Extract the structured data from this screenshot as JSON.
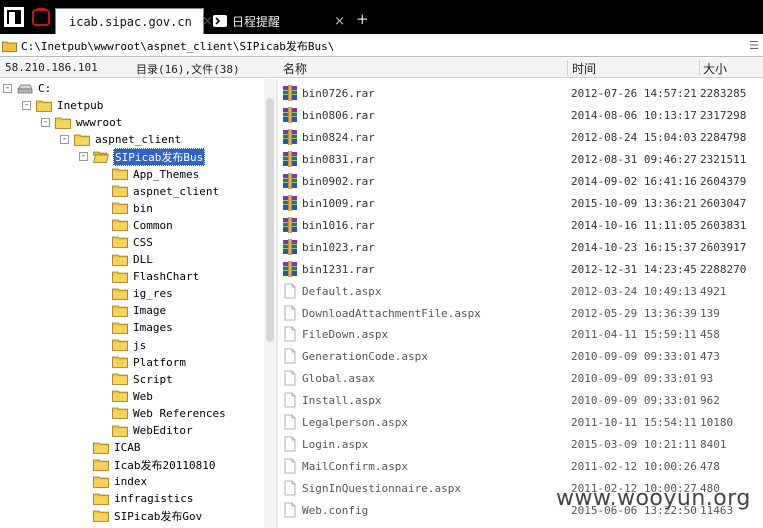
{
  "tabs": [
    {
      "label": "icab.sipac.gov.cn",
      "active": true,
      "icon": "folder-icon"
    },
    {
      "label": "日程提醒",
      "active": false,
      "icon": "terminal-icon"
    }
  ],
  "path": "C:\\Inetpub\\wwwroot\\aspnet_client\\SIPicab发布Bus\\",
  "header": {
    "ip": "58.210.186.101",
    "stats": "目录(16),文件(38)",
    "col_name": "名称",
    "col_time": "时间",
    "col_size": "大小"
  },
  "tree": [
    {
      "label": "C:",
      "icon": "drive-icon",
      "toggle": "−",
      "indent": 0
    },
    {
      "label": "Inetpub",
      "icon": "folder-icon",
      "toggle": "−",
      "indent": 1
    },
    {
      "label": "wwwroot",
      "icon": "folder-icon",
      "toggle": "−",
      "indent": 2
    },
    {
      "label": "aspnet_client",
      "icon": "folder-icon",
      "toggle": "−",
      "indent": 3
    },
    {
      "label": "SIPicab发布Bus",
      "icon": "folder-open-icon",
      "toggle": "−",
      "indent": 4,
      "selected": true
    },
    {
      "label": "App_Themes",
      "icon": "folder-icon",
      "indent": 5
    },
    {
      "label": "aspnet_client",
      "icon": "folder-icon",
      "indent": 5
    },
    {
      "label": "bin",
      "icon": "folder-icon",
      "indent": 5
    },
    {
      "label": "Common",
      "icon": "folder-icon",
      "indent": 5
    },
    {
      "label": "CSS",
      "icon": "folder-icon",
      "indent": 5
    },
    {
      "label": "DLL",
      "icon": "folder-icon",
      "indent": 5
    },
    {
      "label": "FlashChart",
      "icon": "folder-icon",
      "indent": 5
    },
    {
      "label": "ig_res",
      "icon": "folder-icon",
      "indent": 5
    },
    {
      "label": "Image",
      "icon": "folder-icon",
      "indent": 5
    },
    {
      "label": "Images",
      "icon": "folder-icon",
      "indent": 5
    },
    {
      "label": "js",
      "icon": "folder-icon",
      "indent": 5
    },
    {
      "label": "Platform",
      "icon": "folder-icon",
      "indent": 5
    },
    {
      "label": "Script",
      "icon": "folder-icon",
      "indent": 5
    },
    {
      "label": "Web",
      "icon": "folder-icon",
      "indent": 5
    },
    {
      "label": "Web References",
      "icon": "folder-icon",
      "indent": 5
    },
    {
      "label": "WebEditor",
      "icon": "folder-icon",
      "indent": 5
    },
    {
      "label": "ICAB",
      "icon": "folder-icon",
      "indent": 4
    },
    {
      "label": "Icab发布20110810",
      "icon": "folder-icon",
      "indent": 4
    },
    {
      "label": "index",
      "icon": "folder-icon",
      "indent": 4
    },
    {
      "label": "infragistics",
      "icon": "folder-icon",
      "indent": 4
    },
    {
      "label": "SIPicab发布Gov",
      "icon": "folder-icon",
      "indent": 4
    }
  ],
  "files": [
    {
      "name": "bin0726.rar",
      "time": "2012-07-26 14:57:21",
      "size": "2283285",
      "icon": "rar-archive-icon"
    },
    {
      "name": "bin0806.rar",
      "time": "2014-08-06 10:13:17",
      "size": "2317298",
      "icon": "rar-archive-icon"
    },
    {
      "name": "bin0824.rar",
      "time": "2012-08-24 15:04:03",
      "size": "2284798",
      "icon": "rar-archive-icon"
    },
    {
      "name": "bin0831.rar",
      "time": "2012-08-31 09:46:27",
      "size": "2321511",
      "icon": "rar-archive-icon"
    },
    {
      "name": "bin0902.rar",
      "time": "2014-09-02 16:41:16",
      "size": "2604379",
      "icon": "rar-archive-icon"
    },
    {
      "name": "bin1009.rar",
      "time": "2015-10-09 13:36:21",
      "size": "2603047",
      "icon": "rar-archive-icon"
    },
    {
      "name": "bin1016.rar",
      "time": "2014-10-16 11:11:05",
      "size": "2603831",
      "icon": "rar-archive-icon"
    },
    {
      "name": "bin1023.rar",
      "time": "2014-10-23 16:15:37",
      "size": "2603917",
      "icon": "rar-archive-icon"
    },
    {
      "name": "bin1231.rar",
      "time": "2012-12-31 14:23:45",
      "size": "2288270",
      "icon": "rar-archive-icon"
    },
    {
      "name": "Default.aspx",
      "time": "2012-03-24 10:49:13",
      "size": "4921",
      "icon": "file-icon"
    },
    {
      "name": "DownloadAttachmentFile.aspx",
      "time": "2012-05-29 13:36:39",
      "size": "139",
      "icon": "file-icon"
    },
    {
      "name": "FileDown.aspx",
      "time": "2011-04-11 15:59:11",
      "size": "458",
      "icon": "file-icon"
    },
    {
      "name": "GenerationCode.aspx",
      "time": "2010-09-09 09:33:01",
      "size": "473",
      "icon": "file-icon"
    },
    {
      "name": "Global.asax",
      "time": "2010-09-09 09:33:01",
      "size": "93",
      "icon": "file-icon"
    },
    {
      "name": "Install.aspx",
      "time": "2010-09-09 09:33:01",
      "size": "962",
      "icon": "file-icon"
    },
    {
      "name": "Legalperson.aspx",
      "time": "2011-10-11 15:54:11",
      "size": "10180",
      "icon": "file-icon"
    },
    {
      "name": "Login.aspx",
      "time": "2015-03-09 10:21:11",
      "size": "8401",
      "icon": "file-icon"
    },
    {
      "name": "MailConfirm.aspx",
      "time": "2011-02-12 10:00:26",
      "size": "478",
      "icon": "file-icon"
    },
    {
      "name": "SignInQuestionnaire.aspx",
      "time": "2011-02-12 10:00:27",
      "size": "480",
      "icon": "file-icon"
    },
    {
      "name": "Web.config",
      "time": "2015-06-06 13:22:50",
      "size": "11463",
      "icon": "file-icon"
    }
  ],
  "watermark": "www.wooyun.org",
  "colors": {
    "selection": "#3162c6",
    "folder": "#f2c23a",
    "tabbar": "#000000"
  }
}
